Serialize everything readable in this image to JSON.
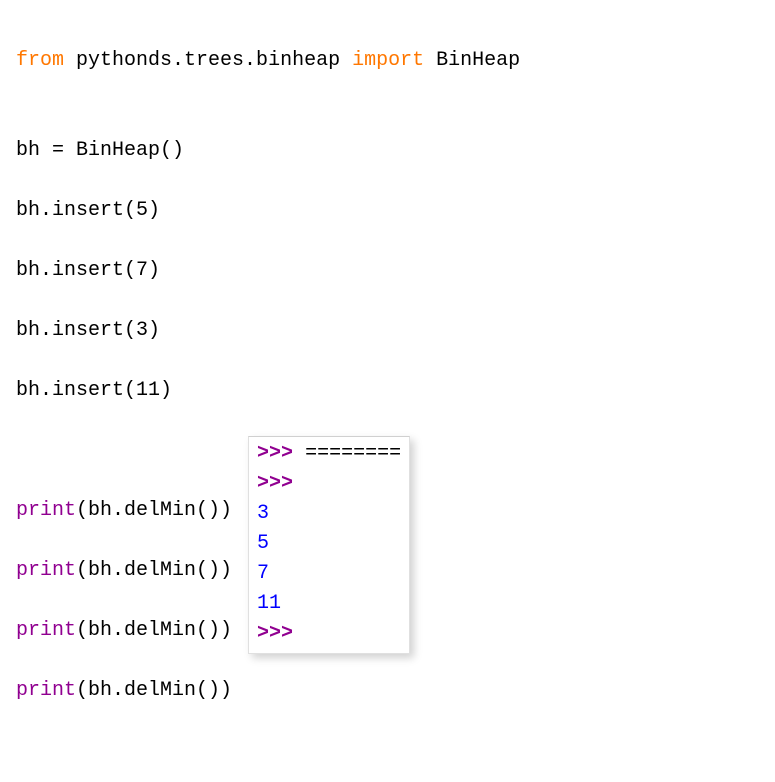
{
  "code": {
    "line1": {
      "kw1": "from",
      "sp1": " ",
      "mod": "pythonds.trees.binheap",
      "sp2": " ",
      "kw2": "import",
      "sp3": " ",
      "name": "BinHeap"
    },
    "blank1": "",
    "line2": "bh = BinHeap()",
    "line3": "bh.insert(5)",
    "line4": "bh.insert(7)",
    "line5": "bh.insert(3)",
    "line6": "bh.insert(11)",
    "blank2": "",
    "print1": {
      "fn": "print",
      "rest": "(bh.delMin())"
    },
    "print2": {
      "fn": "print",
      "rest": "(bh.delMin())"
    },
    "print3": {
      "fn": "print",
      "rest": "(bh.delMin())"
    },
    "print4": {
      "fn": "print",
      "rest": "(bh.delMin())"
    }
  },
  "output": {
    "lines": [
      {
        "prompt": ">>>",
        "text": " ========"
      },
      {
        "prompt": ">>>",
        "text": ""
      },
      {
        "value": "3"
      },
      {
        "value": "5"
      },
      {
        "value": "7"
      },
      {
        "value": "11"
      },
      {
        "prompt": ">>>",
        "text": ""
      }
    ]
  }
}
